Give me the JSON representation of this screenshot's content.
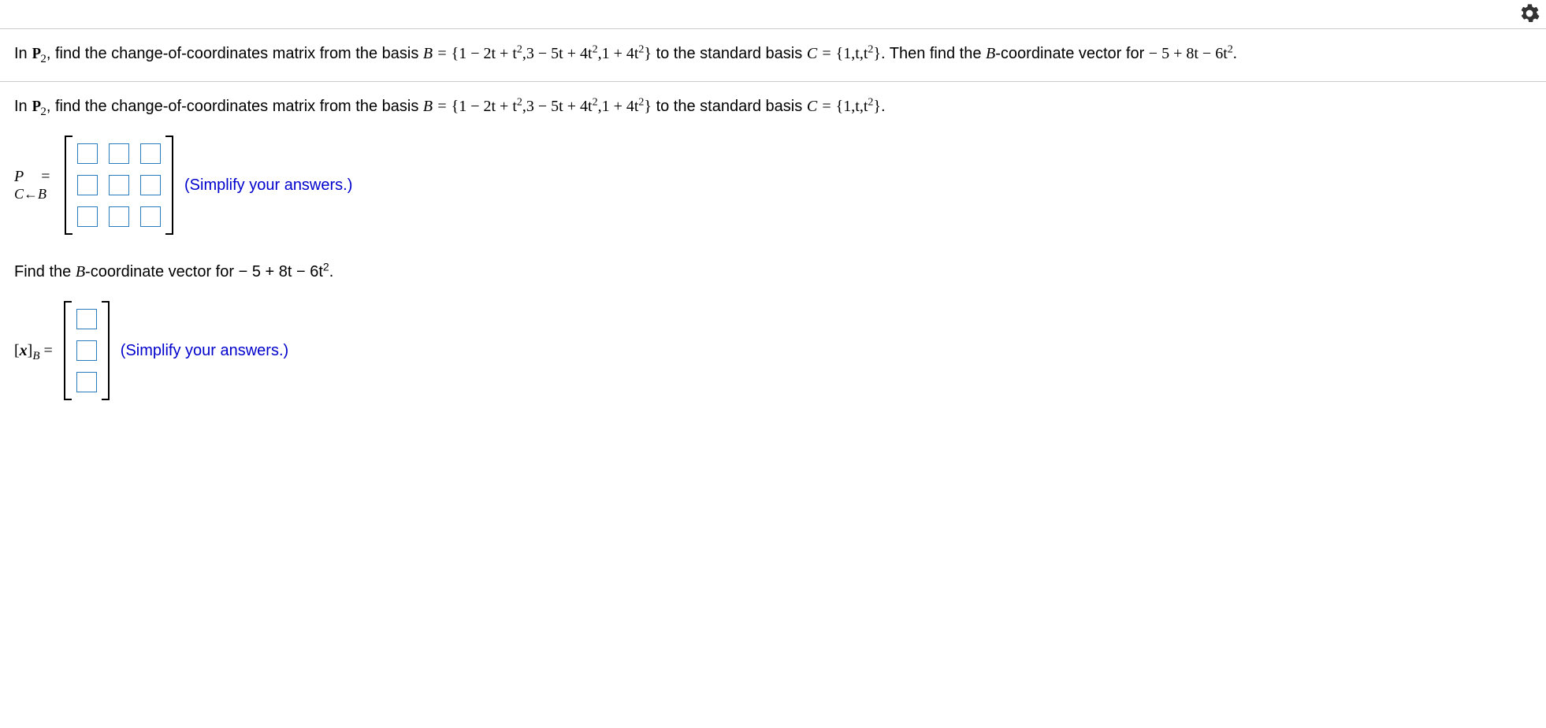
{
  "intro": {
    "pre": "In ",
    "p2": "P",
    "p2_sub": "2",
    "mid1": ", find the change-of-coordinates matrix from the basis ",
    "B_eq": "B = ",
    "B_set": "{1 − 2t + t",
    "sup2a": "2",
    "B_set2": ",3 − 5t + 4t",
    "sup2b": "2",
    "B_set3": ",1 + 4t",
    "sup2c": "2",
    "B_close": "}",
    "mid2": " to the standard basis ",
    "C_eq": "C = ",
    "C_set": "{1,t,t",
    "sup2d": "2",
    "C_close": "}",
    "period": ". Then find the ",
    "bcoord": "B",
    "tail": "-coordinate vector for ",
    "poly": "− 5 + 8t − 6t",
    "sup2e": "2",
    "poly_end": "."
  },
  "part1": {
    "pre": "In ",
    "p2_sub": "2",
    "mid1": ", find the change-of-coordinates matrix from the basis ",
    "B_eq": "B = ",
    "B_set": "{1 − 2t + t",
    "B_set2": ",3 − 5t + 4t",
    "B_set3": ",1 + 4t",
    "B_close": "}",
    "mid2": " to the standard basis ",
    "C_eq": "C = ",
    "C_set": "{1,t,t",
    "C_close": "}",
    "period": ".",
    "lhs_top": "P   =",
    "lhs_bot_c": "C",
    "lhs_bot_arrow": "←",
    "lhs_bot_b": "B",
    "hint": "(Simplify your answers.)"
  },
  "part2": {
    "prompt_pre": "Find the ",
    "prompt_b": "B",
    "prompt_mid": "-coordinate vector for  − 5 + 8t − 6t",
    "sup2": "2",
    "prompt_end": ".",
    "lhs_open": "[",
    "lhs_x": "x",
    "lhs_close": "]",
    "lhs_sub": "B",
    "lhs_eq": " = ",
    "hint": "(Simplify your answers.)"
  }
}
